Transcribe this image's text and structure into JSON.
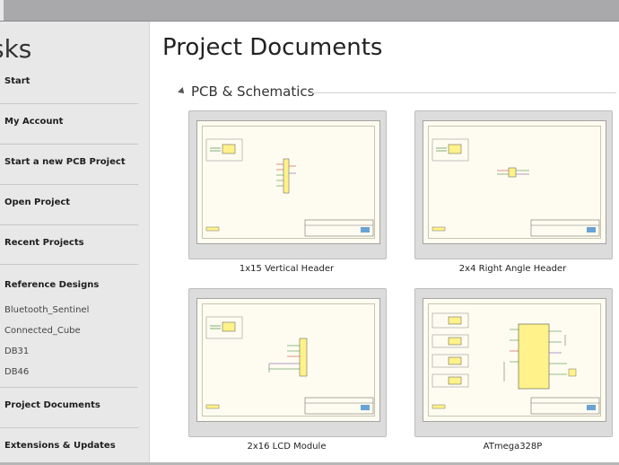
{
  "sidebar": {
    "title": "sks",
    "items": [
      {
        "label": "Start"
      },
      {
        "label": "My Account"
      },
      {
        "label": "Start a new PCB Project"
      },
      {
        "label": "Open Project"
      },
      {
        "label": "Recent Projects"
      },
      {
        "label": "Reference Designs"
      },
      {
        "label": "Project Documents"
      },
      {
        "label": "Extensions & Updates"
      }
    ],
    "reference_designs": [
      "Bluetooth_Sentinel",
      "Connected_Cube",
      "DB31",
      "DB46"
    ]
  },
  "main": {
    "title": "Project Documents",
    "section": "PCB & Schematics",
    "cards": [
      {
        "label": "1x15 Vertical Header"
      },
      {
        "label": "2x4 Right Angle Header"
      },
      {
        "label": "2x16 LCD Module"
      },
      {
        "label": "ATmega328P"
      }
    ]
  },
  "colors": {
    "sidebar_bg": "#e8e8e8",
    "card_bg": "#dcdcdc",
    "schematic_paper": "#fefcf0",
    "component_yellow": "#fff28a"
  }
}
